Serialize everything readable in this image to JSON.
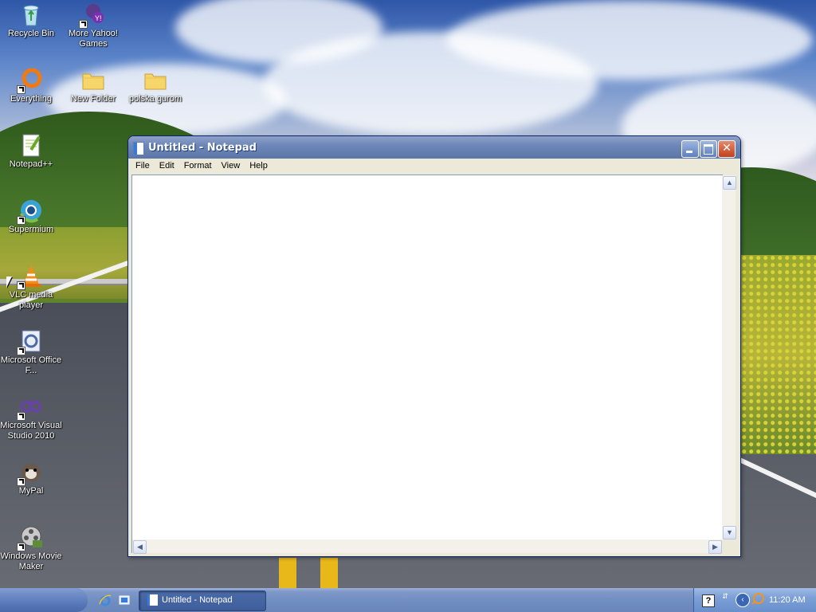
{
  "desktop": {
    "icons": [
      {
        "label": "Recycle Bin",
        "icon": "recycle-bin-icon"
      },
      {
        "label": "More Yahoo! Games",
        "icon": "yahoo-games-icon"
      },
      {
        "label": "Everything",
        "icon": "everything-search-icon"
      },
      {
        "label": "New Folder",
        "icon": "folder-icon"
      },
      {
        "label": "polska gurom",
        "icon": "folder-icon"
      },
      {
        "label": "Notepad++",
        "icon": "notepad-plus-plus-icon"
      },
      {
        "label": "Supermium",
        "icon": "supermium-browser-icon"
      },
      {
        "label": "VLC media player",
        "icon": "vlc-cone-icon"
      },
      {
        "label": "Microsoft Office F...",
        "icon": "office-icon"
      },
      {
        "label": "Microsoft Visual Studio 2010",
        "icon": "visual-studio-icon"
      },
      {
        "label": "MyPal",
        "icon": "mypal-browser-icon"
      },
      {
        "label": "Windows Movie Maker",
        "icon": "movie-maker-icon"
      }
    ]
  },
  "window": {
    "title": "Untitled - Notepad",
    "menu": [
      "File",
      "Edit",
      "Format",
      "View",
      "Help"
    ],
    "content": "",
    "controls": {
      "minimize": "minimize-icon",
      "maximize": "maximize-icon",
      "close": "close-icon"
    }
  },
  "taskbar": {
    "quick_launch": [
      "internet-explorer-icon",
      "show-desktop-icon"
    ],
    "tasks": [
      {
        "label": "Untitled - Notepad",
        "icon": "notepad-icon",
        "active": true
      }
    ],
    "tray": {
      "icons": [
        "help-icon",
        "network-icon",
        "back-arrow-icon",
        "search-icon"
      ],
      "clock": "11:20 AM"
    }
  },
  "colors": {
    "title_bar": "#6d87b8",
    "taskbar": "#6f8cc0",
    "window_face": "#ece9d8"
  }
}
